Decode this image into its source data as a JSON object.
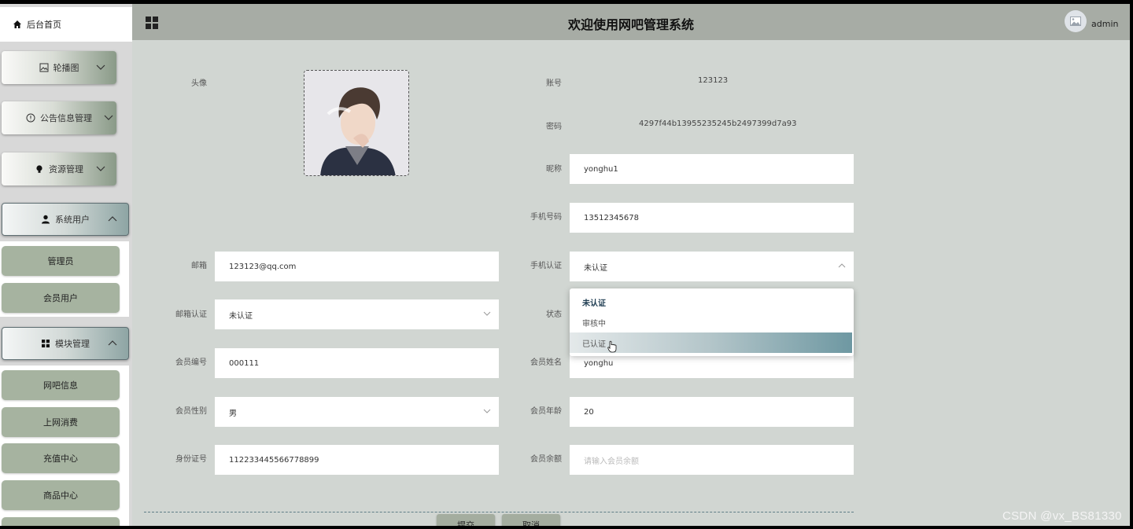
{
  "sidebar": {
    "home_label": "后台首页",
    "menus": [
      {
        "label": "轮播图",
        "icon": "image-icon"
      },
      {
        "label": "公告信息管理",
        "icon": "info-icon"
      },
      {
        "label": "资源管理",
        "icon": "bulb-icon"
      },
      {
        "label": "系统用户",
        "icon": "user-icon"
      },
      {
        "label": "模块管理",
        "icon": "grid-icon"
      }
    ],
    "system_users_items": [
      "管理员",
      "会员用户"
    ],
    "module_items": [
      "网吧信息",
      "上网消费",
      "充值中心",
      "商品中心"
    ]
  },
  "header": {
    "title": "欢迎使用网吧管理系统",
    "username": "admin"
  },
  "form": {
    "avatar_label": "头像",
    "account_label": "账号",
    "account_value": "123123",
    "password_label": "密码",
    "password_value": "4297f44b13955235245b2497399d7a93",
    "nickname_label": "昵称",
    "nickname_value": "yonghu1",
    "phone_label": "手机号码",
    "phone_value": "13512345678",
    "email_label": "邮箱",
    "email_value": "123123@qq.com",
    "phone_verify_label": "手机认证",
    "phone_verify_value": "未认证",
    "email_verify_label": "邮箱认证",
    "email_verify_value": "未认证",
    "status_label": "状态",
    "member_no_label": "会员编号",
    "member_no_value": "000111",
    "member_name_label": "会员姓名",
    "member_name_value": "yonghu",
    "gender_label": "会员性别",
    "gender_value": "男",
    "age_label": "会员年龄",
    "age_value": "20",
    "id_card_label": "身份证号",
    "id_card_value": "112233445566778899",
    "balance_label": "会员余额",
    "balance_placeholder": "请输入会员余额"
  },
  "dropdown_options": [
    "未认证",
    "审核中",
    "已认证"
  ],
  "buttons": {
    "submit": "提交",
    "cancel": "取消"
  },
  "watermark": "CSDN @vx_BS81330"
}
